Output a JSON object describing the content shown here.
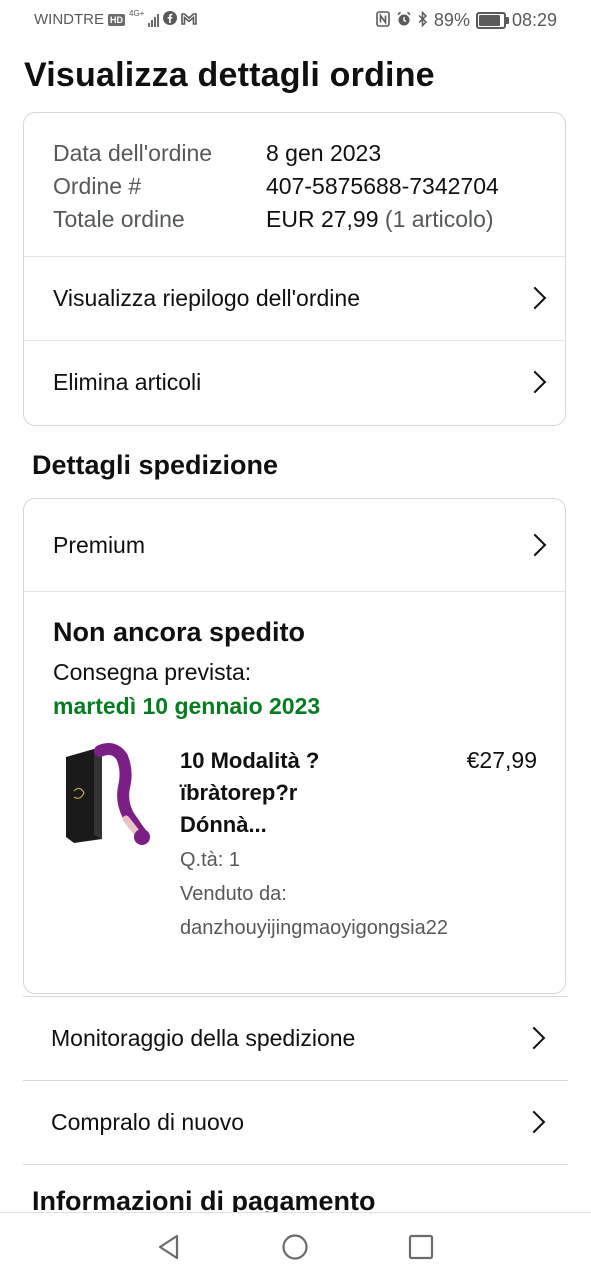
{
  "status_bar": {
    "carrier": "WINDTRE",
    "hd_badge": "HD",
    "network": "4G+",
    "battery": "89%",
    "time": "08:29",
    "icons": [
      "facebook-icon",
      "gmail-icon",
      "nfc-icon",
      "alarm-icon",
      "bluetooth-icon"
    ]
  },
  "page": {
    "title": "Visualizza dettagli ordine"
  },
  "order": {
    "date_label": "Data dell'ordine",
    "date_value": "8 gen 2023",
    "number_label": "Ordine #",
    "number_value": "407-5875688-7342704",
    "total_label": "Totale ordine",
    "total_value": "EUR 27,99",
    "total_items": "(1 articolo)",
    "view_summary": "Visualizza riepilogo dell'ordine",
    "delete_items": "Elimina articoli"
  },
  "shipping": {
    "section_title": "Dettagli spedizione",
    "service": "Premium",
    "status": "Non ancora spedito",
    "delivery_label": "Consegna prevista:",
    "delivery_date": "martedì 10 gennaio 2023",
    "delivery_date_color": "#067d20",
    "product": {
      "title_line1": "10 Modalità ?",
      "title_line2": "ïbràtorep?r",
      "title_line3": "Dónnà...",
      "price": "€27,99",
      "quantity": "Q.tà: 1",
      "sold_by_label": "Venduto da:",
      "seller": "danzhouyijingmaoyigongsia22"
    }
  },
  "actions": {
    "track": "Monitoraggio della spedizione",
    "buy_again": "Compralo di nuovo"
  },
  "payment": {
    "section_title": "Informazioni di pagamento"
  },
  "navbar": {
    "icons": [
      "back-triangle-icon",
      "home-circle-icon",
      "recents-square-icon"
    ]
  }
}
